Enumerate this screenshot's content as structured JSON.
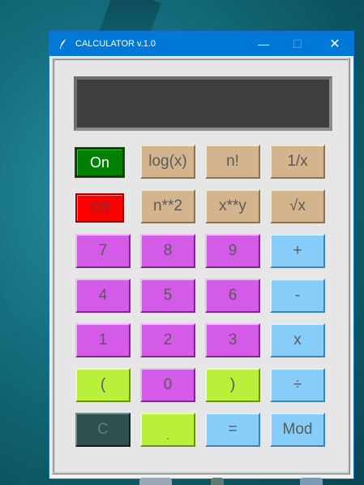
{
  "window": {
    "title": "CALCULATOR v.1.0",
    "minimize_glyph": "—",
    "maximize_glyph": "☐",
    "close_glyph": "✕",
    "app_icon": "feather-icon"
  },
  "display": {
    "value": ""
  },
  "colors": {
    "titlebar": "#0078d7",
    "display_bg": "#3e3e3e",
    "tan": "#d3b48c",
    "purple": "#d45ae8",
    "blue": "#87cdfa",
    "lime": "#b8f03a",
    "dark": "#2f4f4f",
    "on": "#008000",
    "off": "#ff0000"
  },
  "keys": {
    "on": "On",
    "off": "Off",
    "log": "log(x)",
    "fact": "n!",
    "recip": "1/x",
    "square": "n**2",
    "power": "x**y",
    "sqrt": "√x",
    "d7": "7",
    "d8": "8",
    "d9": "9",
    "plus": "+",
    "d4": "4",
    "d5": "5",
    "d6": "6",
    "minus": "-",
    "d1": "1",
    "d2": "2",
    "d3": "3",
    "times": "x",
    "lparen": "(",
    "d0": "0",
    "rparen": ")",
    "divide": "÷",
    "clear": "C",
    "dot": ".",
    "equals": "=",
    "mod": "Mod"
  }
}
